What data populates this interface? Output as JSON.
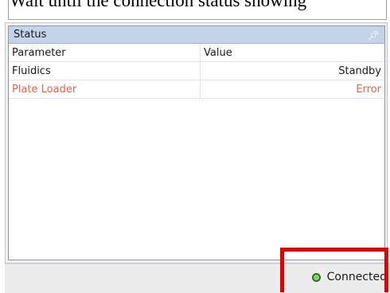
{
  "caption": "Wait until the connection status showing",
  "status_panel": {
    "title": "Status",
    "pin_icon": "pin-icon",
    "columns": [
      "Parameter",
      "Value"
    ],
    "rows": [
      {
        "parameter": "Fluidics",
        "value": "Standby",
        "state": "normal"
      },
      {
        "parameter": "Plate Loader",
        "value": "Error",
        "state": "error"
      }
    ]
  },
  "status_bar": {
    "connection_label": "Connected",
    "connection_icon": "status-led-icon",
    "led_color": "#6fd14a"
  },
  "colors": {
    "header_bg": "#c3d3ea",
    "error_text": "#e8624a",
    "highlight": "#e00000"
  }
}
